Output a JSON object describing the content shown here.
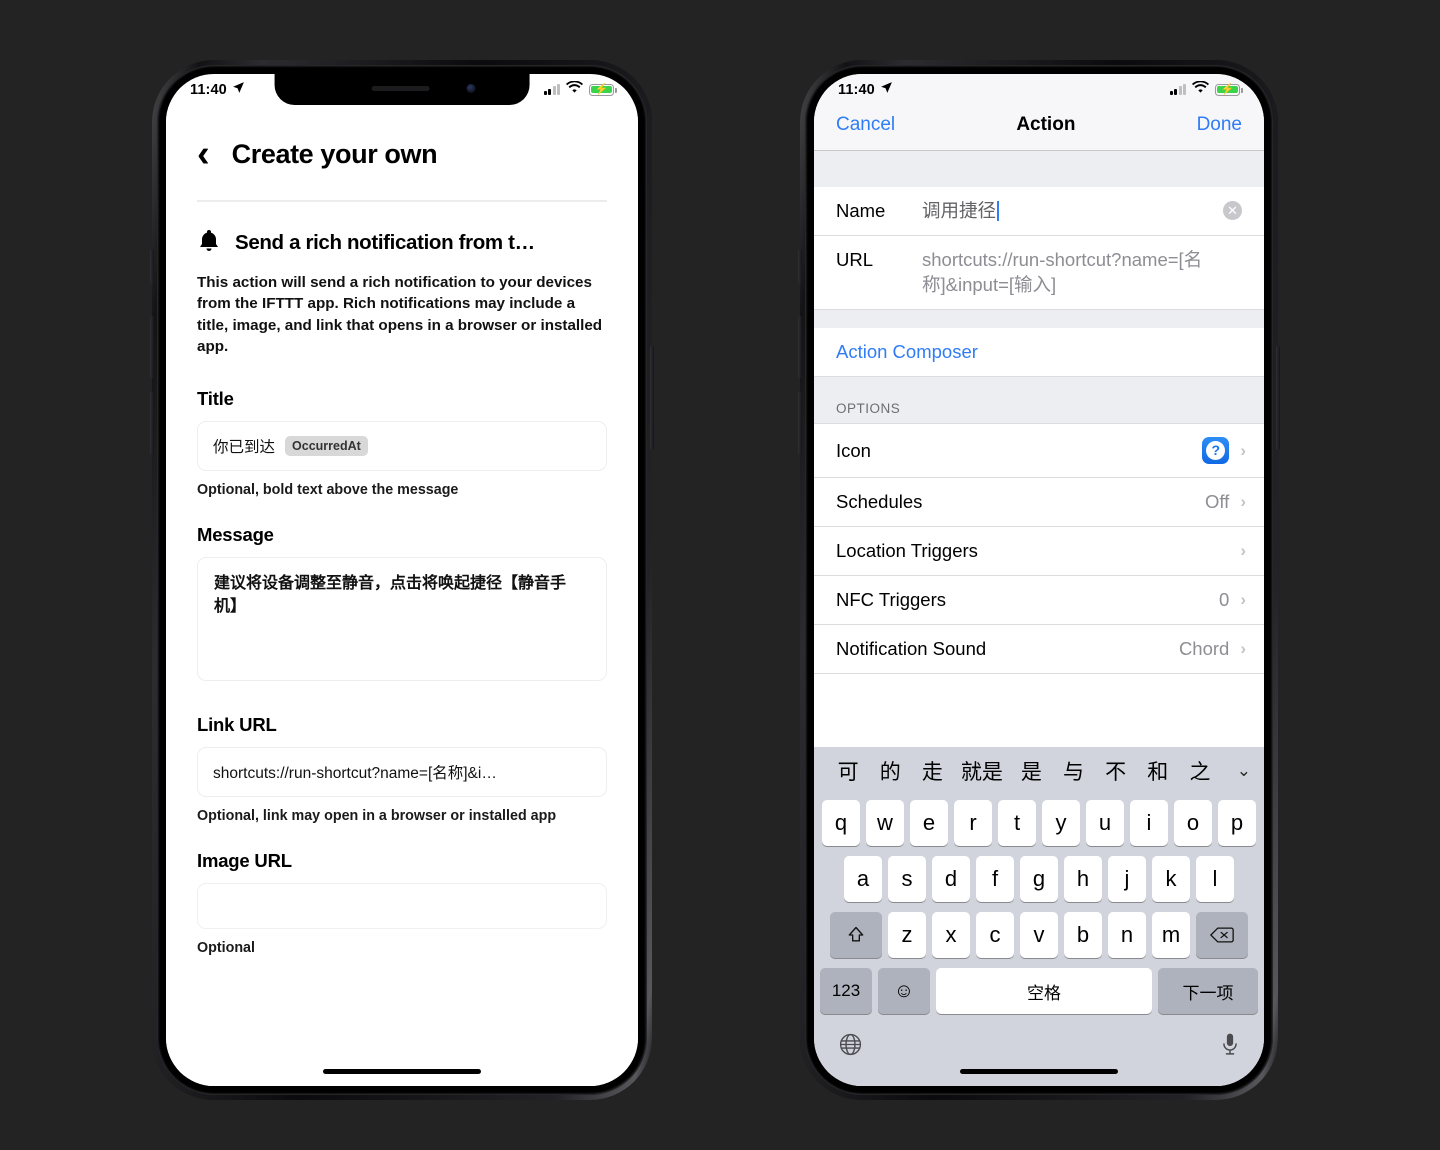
{
  "background_color": "#232323",
  "phone1": {
    "status_bar": {
      "time": "11:40",
      "location_icon": "location-arrow-icon",
      "signal_bars_filled": 2,
      "signal_bars_total": 4,
      "wifi": "wifi-icon",
      "battery": "battery-charging-icon",
      "battery_color": "#3ad44b"
    },
    "nav": {
      "back_icon": "chevron-left-icon",
      "title": "Create your own"
    },
    "action": {
      "icon": "bell-icon",
      "name": "Send a rich notification from t…",
      "description": "This action will send a rich notification to your devices from the IFTTT app. Rich notifications may include a title, image, and link that opens in a browser or installed app."
    },
    "fields": [
      {
        "label": "Title",
        "value": "你已到达",
        "chip": "OccurredAt",
        "hint": "Optional, bold text above the message"
      },
      {
        "label": "Message",
        "value": "建议将设备调整至静音，点击将唤起捷径【静音手机】",
        "hint": ""
      },
      {
        "label": "Link URL",
        "value": "shortcuts://run-shortcut?name=[名称]&i…",
        "hint": "Optional, link may open in a browser or installed app"
      },
      {
        "label": "Image URL",
        "value": "",
        "hint": "Optional"
      }
    ]
  },
  "phone2": {
    "status_bar": {
      "time": "11:40",
      "location_icon": "location-arrow-icon",
      "signal_bars_filled": 2,
      "signal_bars_total": 4,
      "wifi": "wifi-icon",
      "battery": "battery-charging-icon",
      "battery_color": "#3ad44b"
    },
    "nav": {
      "cancel": "Cancel",
      "title": "Action",
      "done": "Done",
      "accent": "#2f7cf6"
    },
    "form": {
      "name_label": "Name",
      "name_value": "调用捷径",
      "clear_icon": "clear-circle-icon",
      "url_label": "URL",
      "url_value": "shortcuts://run-shortcut?name=[名称]&input=[输入]",
      "composer_link": "Action Composer"
    },
    "options_header": "OPTIONS",
    "options": [
      {
        "label": "Icon",
        "value": "",
        "icon": "question-mark-app-icon",
        "chevron": "chevron-right-icon"
      },
      {
        "label": "Schedules",
        "value": "Off",
        "chevron": "chevron-right-icon"
      },
      {
        "label": "Location Triggers",
        "value": "",
        "chevron": "chevron-right-icon"
      },
      {
        "label": "NFC Triggers",
        "value": "0",
        "chevron": "chevron-right-icon"
      },
      {
        "label": "Notification Sound",
        "value": "Chord",
        "chevron": "chevron-right-icon"
      }
    ],
    "keyboard": {
      "candidates": [
        "可",
        "的",
        "走",
        "就是",
        "是",
        "与",
        "不",
        "和",
        "之"
      ],
      "expand_icon": "chevron-down-icon",
      "row1": [
        "q",
        "w",
        "e",
        "r",
        "t",
        "y",
        "u",
        "i",
        "o",
        "p"
      ],
      "row2": [
        "a",
        "s",
        "d",
        "f",
        "g",
        "h",
        "j",
        "k",
        "l"
      ],
      "row3": [
        "z",
        "x",
        "c",
        "v",
        "b",
        "n",
        "m"
      ],
      "shift_icon": "shift-up-icon",
      "backspace_icon": "backspace-delete-icon",
      "numeric_key": "123",
      "emoji_icon": "smiley-face-icon",
      "space_key": "空格",
      "next_key": "下一项",
      "globe_icon": "globe-icon",
      "mic_icon": "microphone-icon"
    }
  }
}
